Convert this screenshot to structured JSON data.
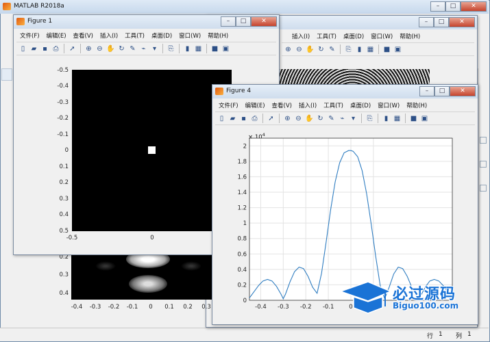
{
  "main": {
    "title": "MATLAB R2018a",
    "status_row_label": "行",
    "status_row_value": "1",
    "status_col_label": "列",
    "status_col_value": "1"
  },
  "window_buttons": {
    "minimize": "–",
    "maximize": "□",
    "close": "✕"
  },
  "figure1": {
    "title": "Figure 1",
    "menu": [
      "文件(F)",
      "编辑(E)",
      "查看(V)",
      "插入(I)",
      "工具(T)",
      "桌面(D)",
      "窗口(W)",
      "帮助(H)"
    ],
    "y_ticks": [
      "-0.5",
      "-0.4",
      "-0.3",
      "-0.2",
      "-0.1",
      "0",
      "0.1",
      "0.2",
      "0.3",
      "0.4",
      "0.5"
    ],
    "x_ticks": [
      "-0.5",
      "0"
    ]
  },
  "background_figure": {
    "y_ticks": [
      "0.2",
      "0.3",
      "0.4"
    ],
    "x_ticks": [
      "-0.4",
      "-0.3",
      "-0.2",
      "-0.1",
      "0",
      "0.1",
      "0.2",
      "0.3"
    ],
    "menu": [
      "插入(I)",
      "工具(T)",
      "桌面(D)",
      "窗口(W)",
      "帮助(H)"
    ]
  },
  "figure4": {
    "title": "Figure 4",
    "menu": [
      "文件(F)",
      "编辑(E)",
      "查看(V)",
      "插入(I)",
      "工具(T)",
      "桌面(D)",
      "窗口(W)",
      "帮助(H)"
    ],
    "exponent_label": "× 10",
    "exponent_power": "4"
  },
  "chart_data": {
    "type": "line",
    "x": [
      -0.45,
      -0.43,
      -0.41,
      -0.39,
      -0.37,
      -0.35,
      -0.33,
      -0.31,
      -0.3,
      -0.29,
      -0.27,
      -0.25,
      -0.23,
      -0.21,
      -0.19,
      -0.17,
      -0.15,
      -0.13,
      -0.11,
      -0.09,
      -0.07,
      -0.05,
      -0.03,
      -0.01,
      0,
      0.01,
      0.03,
      0.05,
      0.07,
      0.09,
      0.11,
      0.13,
      0.15,
      0.17,
      0.19,
      0.21,
      0.23,
      0.25,
      0.27,
      0.29,
      0.3,
      0.31,
      0.33,
      0.35,
      0.37,
      0.39,
      0.41,
      0.43,
      0.45
    ],
    "y": [
      0.03,
      0.11,
      0.19,
      0.25,
      0.27,
      0.25,
      0.18,
      0.08,
      0.02,
      0.08,
      0.24,
      0.37,
      0.43,
      0.41,
      0.31,
      0.17,
      0.09,
      0.35,
      0.75,
      1.17,
      1.53,
      1.78,
      1.91,
      1.94,
      1.94,
      1.93,
      1.86,
      1.68,
      1.38,
      0.99,
      0.57,
      0.19,
      0.02,
      0.17,
      0.34,
      0.43,
      0.41,
      0.31,
      0.17,
      0.05,
      0.02,
      0.06,
      0.17,
      0.25,
      0.27,
      0.25,
      0.19,
      0.11,
      0.03
    ],
    "x_ticks": [
      -0.4,
      -0.3,
      -0.2,
      -0.1,
      0,
      0.1
    ],
    "y_ticks": [
      0,
      0.2,
      0.4,
      0.6,
      0.8,
      1,
      1.2,
      1.4,
      1.6,
      1.8,
      2
    ],
    "xlim": [
      -0.45,
      0.45
    ],
    "ylim": [
      0,
      2.1
    ],
    "grid": true,
    "line_color": "#2f7dc1"
  },
  "watermark": {
    "text": "必过源码",
    "url": "Biguo100.com"
  }
}
